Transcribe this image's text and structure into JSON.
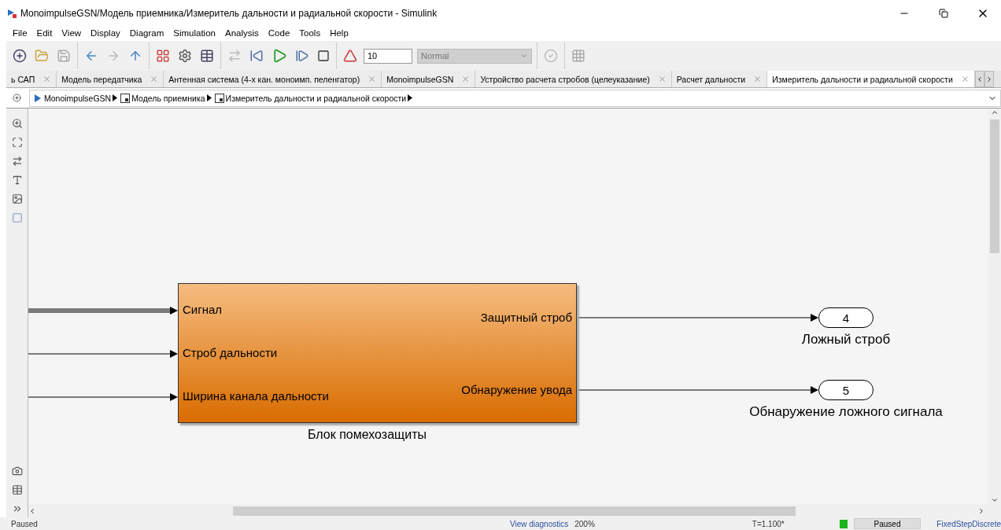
{
  "window": {
    "title": "MonoimpulseGSN/Модель приемника/Измеритель дальности и радиальной скорости - Simulink"
  },
  "menu": [
    "File",
    "Edit",
    "View",
    "Display",
    "Diagram",
    "Simulation",
    "Analysis",
    "Code",
    "Tools",
    "Help"
  ],
  "toolbar": {
    "stop_time": "10",
    "mode": {
      "value": "Normal",
      "disabled": true
    }
  },
  "tabs": [
    {
      "label": "ь САП",
      "selected": false
    },
    {
      "label": "Модель передатчика",
      "selected": false
    },
    {
      "label": "Антенная система (4-х кан. моноимп. пеленгатор)",
      "selected": false
    },
    {
      "label": "MonoimpulseGSN",
      "selected": false
    },
    {
      "label": "Устройство расчета стробов (целеуказание)",
      "selected": false
    },
    {
      "label": "Расчет дальности",
      "selected": false
    },
    {
      "label": "Измеритель дальности и радиальной скорости",
      "selected": true
    }
  ],
  "breadcrumb": [
    {
      "label": "MonoimpulseGSN",
      "kind": "model"
    },
    {
      "label": "Модель приемника",
      "kind": "subsystem"
    },
    {
      "label": "Измеритель дальности и радиальной скорости",
      "kind": "subsystem"
    }
  ],
  "subsystem": {
    "name": "Блок помехозащиты",
    "inputs": [
      {
        "label": "Сигнал",
        "kind": "bus"
      },
      {
        "label": "Строб дальности",
        "kind": "signal"
      },
      {
        "label": "Ширина канала дальности",
        "kind": "signal"
      }
    ],
    "outputs": [
      "Защитный строб",
      "Обнаружение увода"
    ]
  },
  "outports": [
    {
      "number": "4",
      "label": "Ложный строб"
    },
    {
      "number": "5",
      "label": "Обнаружение ложного сигнала"
    }
  ],
  "status_bar": {
    "state": "Paused",
    "diagnostics": "View diagnostics",
    "zoom": "200%",
    "time": "T=1.100*",
    "progress": "Paused",
    "solver": "FixedStepDiscrete"
  }
}
